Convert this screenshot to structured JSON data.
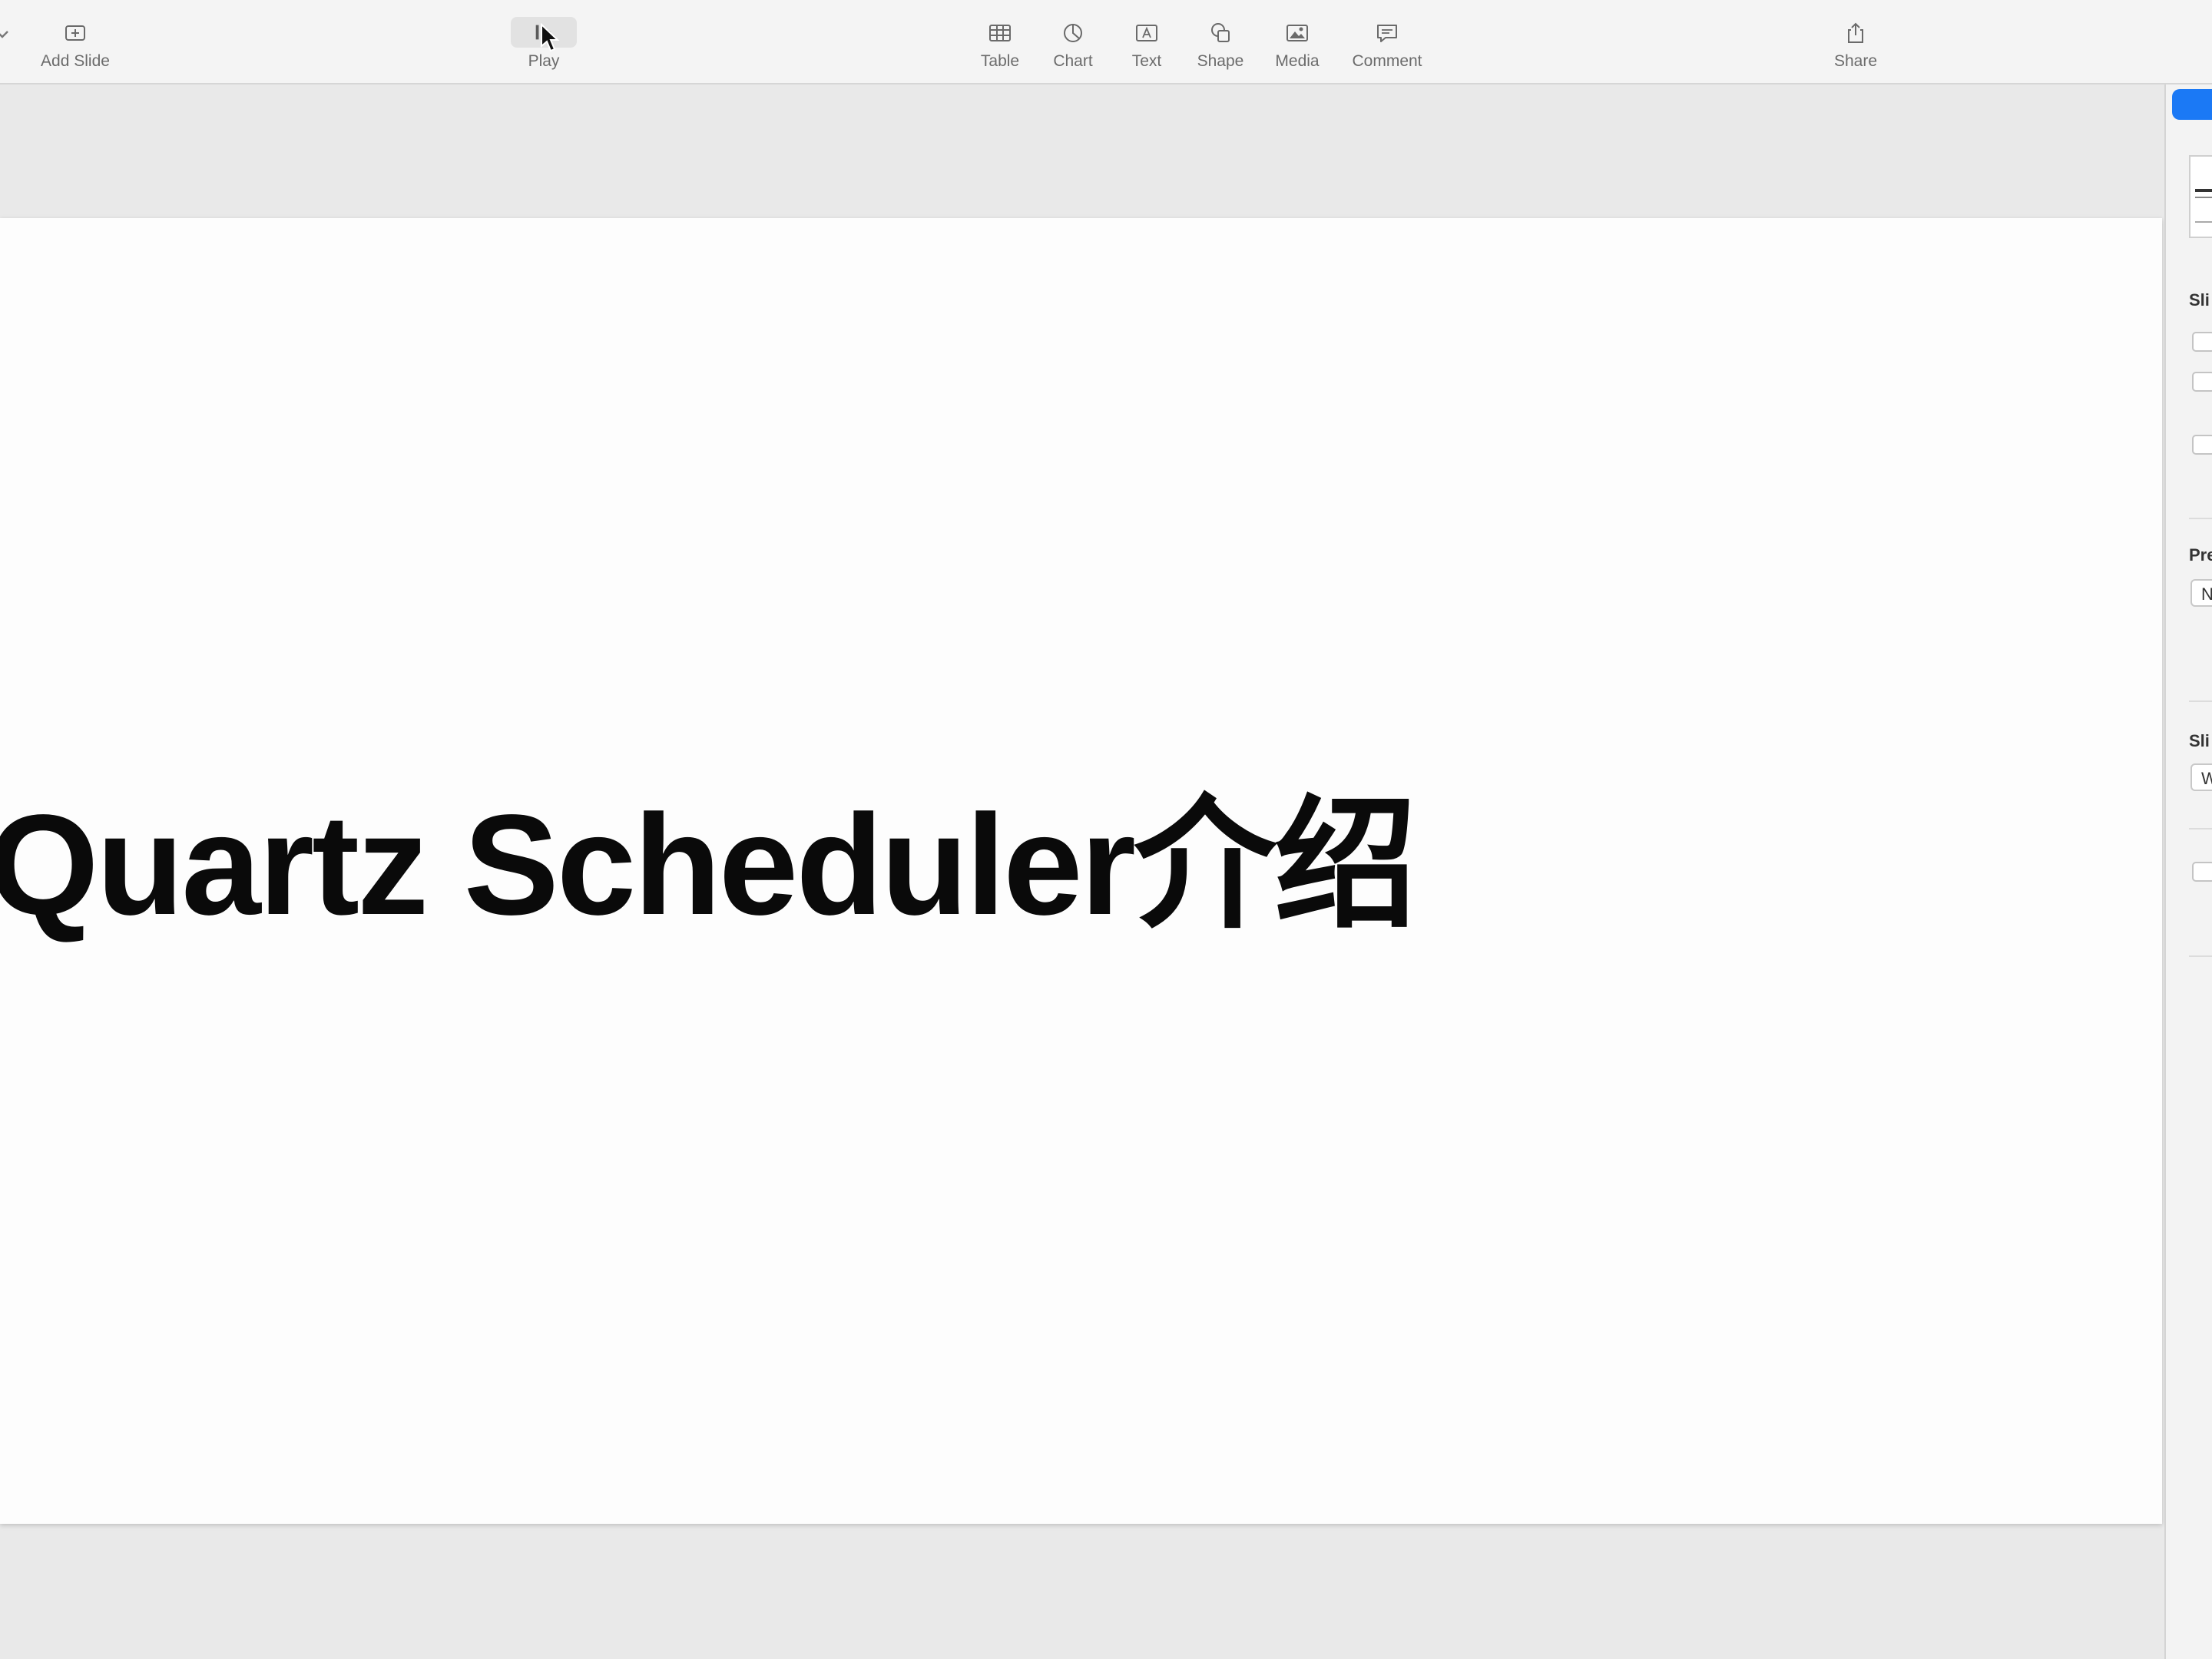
{
  "toolbar": {
    "items": [
      {
        "id": "add-slide",
        "label": "Add Slide",
        "icon": "add-slide-icon"
      },
      {
        "id": "play",
        "label": "Play",
        "icon": "play-icon"
      },
      {
        "id": "table",
        "label": "Table",
        "icon": "table-icon"
      },
      {
        "id": "chart",
        "label": "Chart",
        "icon": "chart-icon"
      },
      {
        "id": "text",
        "label": "Text",
        "icon": "text-box-icon"
      },
      {
        "id": "shape",
        "label": "Shape",
        "icon": "shape-icon"
      },
      {
        "id": "media",
        "label": "Media",
        "icon": "media-icon"
      },
      {
        "id": "comment",
        "label": "Comment",
        "icon": "comment-icon"
      },
      {
        "id": "share",
        "label": "Share",
        "icon": "share-icon"
      }
    ]
  },
  "slide": {
    "title": "Quartz Scheduler介绍"
  },
  "inspector": {
    "section_slide_label": "Sli",
    "section_presenter_label": "Pre",
    "presenter_popup_value": "N",
    "section_slide_layout_label": "Sli",
    "slide_layout_popup_value": "W"
  },
  "colors": {
    "accent": "#1b79f5",
    "toolbar_bg": "#f4f4f4",
    "canvas_bg": "#e9e9e9",
    "slide_bg": "#fdfdfd",
    "title_text": "#0a0a0a"
  }
}
